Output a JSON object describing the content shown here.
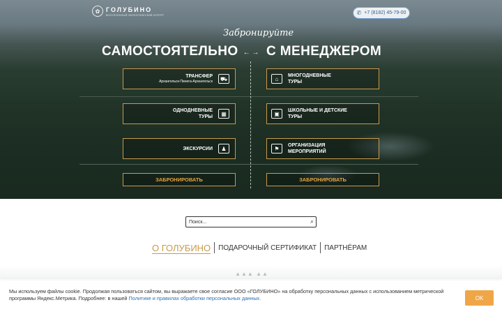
{
  "header": {
    "logo_name": "ГОЛУБИНО",
    "logo_sub": "ВСЕСЕЗОННЫЙ ЭКОЛОГИЧЕСКИЙ КУРОРТ",
    "phone": "+7 (8182) 45-79-00",
    "phone_icon": "phone-icon"
  },
  "hero": {
    "script_title": "Забронируйте",
    "left_heading": "САМОСТОЯТЕЛЬНО",
    "arrows": "← →",
    "right_heading": "С МЕНЕДЖЕРОМ",
    "left_cards": [
      {
        "title": "ТРАНСФЕР",
        "subtitle": "Архангельск-Пинега-Архангельск",
        "icon": "bus-icon"
      },
      {
        "title": "ОДНОДНЕВНЫЕ ТУРЫ",
        "icon": "calendar-icon"
      },
      {
        "title": "ЭКСКУРСИИ",
        "icon": "guide-icon"
      }
    ],
    "right_cards": [
      {
        "title": "МНОГОДНЕВНЫЕ ТУРЫ",
        "icon": "house-icon"
      },
      {
        "title": "ШКОЛЬНЫЕ И ДЕТСКИЕ ТУРЫ",
        "icon": "backpack-icon"
      },
      {
        "title": "ОРГАНИЗАЦИЯ МЕРОПРИЯТИЙ",
        "icon": "event-icon"
      }
    ],
    "book_left": "ЗАБРОНИРОВАТЬ",
    "book_right": "ЗАБРОНИРОВАТЬ"
  },
  "search": {
    "placeholder": "Поиск..."
  },
  "tabs": [
    {
      "label": "О ГОЛУБИНО",
      "active": true
    },
    {
      "label": "ПОДАРОЧНЫЙ СЕРТИФИКАТ"
    },
    {
      "label": "ПАРТНЁРАМ"
    }
  ],
  "cookie": {
    "text": "Мы используем файлы cookie. Продолжая пользоваться сайтом, вы выражаете свое согласие ООО «ГОЛУБИНО» на обработку персональных данных с использованием метрической программы Яндекс.Метрика. Подробнее: в нашей",
    "link": "Политике и правилах обработки персональных данных.",
    "ok": "OK"
  },
  "colors": {
    "accent": "#c89a4e",
    "book_text": "#e4a53e",
    "ok_button": "#f0a646",
    "link": "#2b6fb3"
  }
}
